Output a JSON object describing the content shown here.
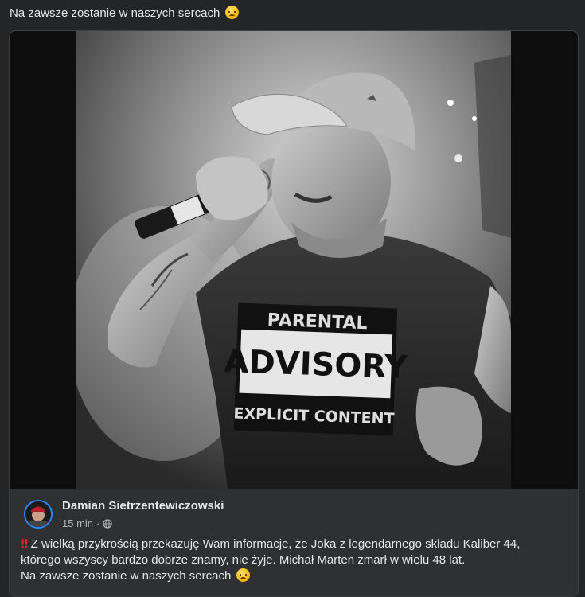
{
  "post": {
    "text": "Na zawsze zostanie w naszych sercach",
    "emoji": "sad-face-emoji"
  },
  "shared_post": {
    "author": "Damian Sietrzentewiczowski",
    "time": "15 min",
    "separator": "·",
    "privacy_icon": "globe-icon",
    "bang": "‼",
    "line1": "Z wielką przykrością przekazuję Wam informacje, że Joka z legendarnego składu Kaliber 44,",
    "line2": "którego wszyscy bardzo dobrze znamy,  nie żyje. Michał Marten zmarł w wielu 48 lat.",
    "line3": "Na zawsze zostanie w naszych sercach"
  },
  "photo": {
    "shirt_line1": "PARENTAL",
    "shirt_line2": "ADVISORY",
    "shirt_line3": "EXPLICIT CONTENT"
  },
  "colors": {
    "background": "#242526",
    "card_footer": "#2f3031",
    "avatar_ring": "#2d88ff",
    "bang": "#e0262d"
  }
}
